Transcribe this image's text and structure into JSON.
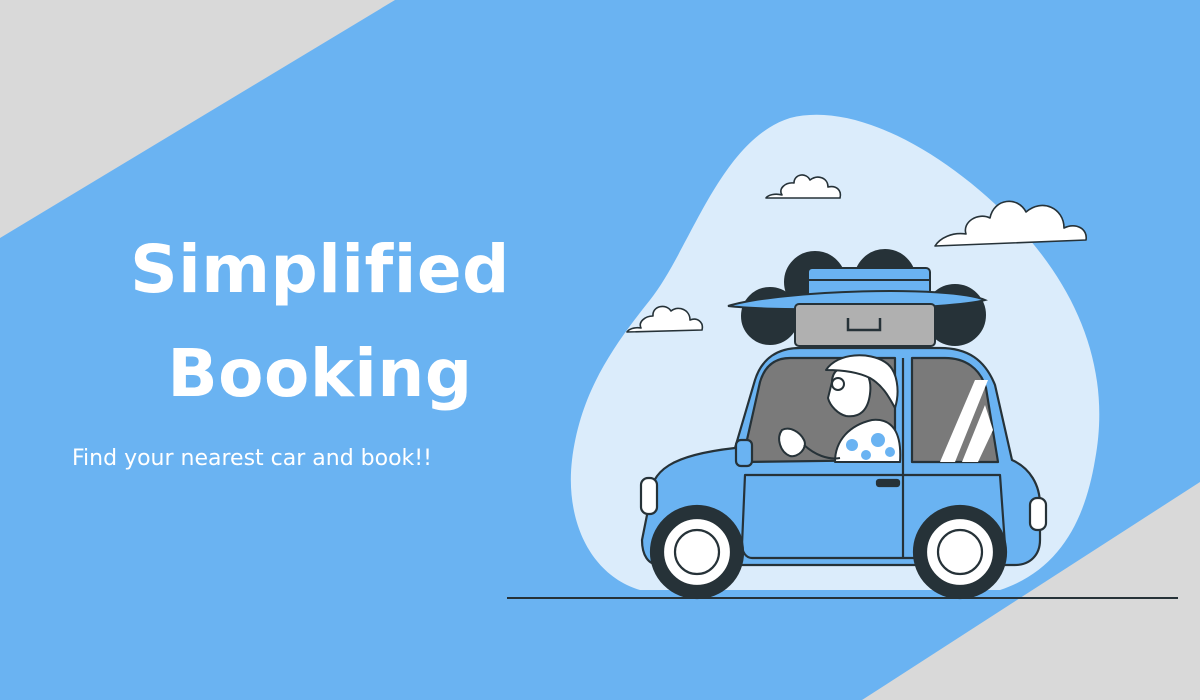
{
  "hero": {
    "title_line1": "Simplified",
    "title_line2": "Booking",
    "subtitle": "Find your nearest car and book!!"
  },
  "colors": {
    "background_gray": "#d9d9d9",
    "band_blue": "#6ab3f2",
    "blob_light": "#dbecfb",
    "outline": "#263238",
    "text": "#ffffff"
  },
  "illustration": {
    "icons": [
      "cloud-icon",
      "car-icon",
      "driver-icon",
      "luggage-icon",
      "surfboard-icon"
    ]
  }
}
